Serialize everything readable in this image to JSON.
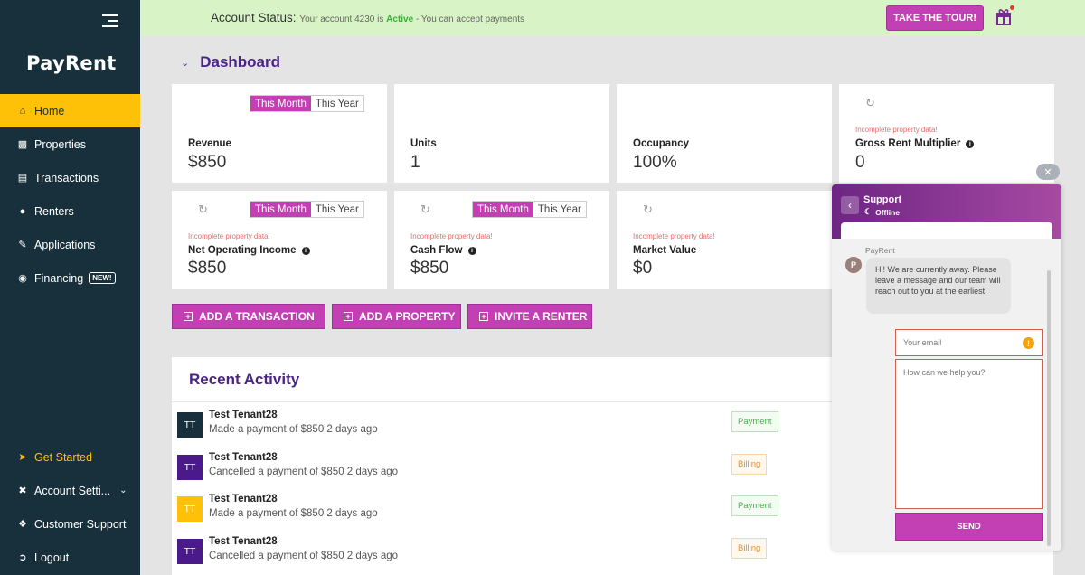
{
  "brand": {
    "logo_text": "PayRent"
  },
  "sidebar": {
    "items": [
      {
        "label": "Home",
        "icon": "home-icon"
      },
      {
        "label": "Properties",
        "icon": "buildings-icon"
      },
      {
        "label": "Transactions",
        "icon": "receipt-icon"
      },
      {
        "label": "Renters",
        "icon": "users-icon"
      },
      {
        "label": "Applications",
        "icon": "clipboard-icon"
      },
      {
        "label": "Financing",
        "icon": "money-bag-icon",
        "badge": "NEW!"
      }
    ],
    "bottom_items": [
      {
        "label": "Get Started",
        "icon": "rocket-icon"
      },
      {
        "label": "Account Setti...",
        "icon": "tools-icon"
      },
      {
        "label": "Customer Support",
        "icon": "support-icon"
      },
      {
        "label": "Logout",
        "icon": "logout-icon"
      }
    ]
  },
  "topbar": {
    "status_label": "Account Status:",
    "status_prefix": "Your account 4230 is",
    "status_active": "Active",
    "status_suffix": "- You can accept payments",
    "tour_button": "TAKE THE TOUR!"
  },
  "dashboard": {
    "title": "Dashboard",
    "toggle": {
      "month": "This Month",
      "year": "This Year"
    },
    "warning": "Incomplete property data!",
    "cards": [
      {
        "label": "Revenue",
        "value": "$850"
      },
      {
        "label": "Units",
        "value": "1"
      },
      {
        "label": "Occupancy",
        "value": "100%"
      },
      {
        "label": "Gross Rent Multiplier",
        "value": "0"
      },
      {
        "label": "Net Operating Income",
        "value": "$850"
      },
      {
        "label": "Cash Flow",
        "value": "$850"
      },
      {
        "label": "Market Value",
        "value": "$0"
      }
    ],
    "actions": {
      "add_transaction": "ADD A TRANSACTION",
      "add_property": "ADD A PROPERTY",
      "invite_renter": "INVITE A RENTER"
    }
  },
  "recent_activity": {
    "title": "Recent Activity",
    "rows": [
      {
        "initials": "TT",
        "name": "Test Tenant28",
        "desc": "Made a payment of $850 2 days ago",
        "tag": "Payment",
        "avatar_color": "#17303b"
      },
      {
        "initials": "TT",
        "name": "Test Tenant28",
        "desc": "Cancelled a payment of $850 2 days ago",
        "tag": "Billing",
        "avatar_color": "#4b1a8a"
      },
      {
        "initials": "TT",
        "name": "Test Tenant28",
        "desc": "Made a payment of $850 2 days ago",
        "tag": "Payment",
        "avatar_color": "#ffc107"
      },
      {
        "initials": "TT",
        "name": "Test Tenant28",
        "desc": "Cancelled a payment of $850 2 days ago",
        "tag": "Billing",
        "avatar_color": "#4b1a8a"
      }
    ]
  },
  "chat": {
    "title": "Support",
    "status": "Offline",
    "sender": "PayRent",
    "avatar_letter": "P",
    "message": "Hi! We are currently away. Please leave a message and our team will reach out to you at the earliest.",
    "email_placeholder": "Your email",
    "message_placeholder": "How can we help you?",
    "send_label": "SEND"
  },
  "colors": {
    "sidebar": "#17303b",
    "accent": "#c340b4",
    "highlight": "#ffc107",
    "heading": "#4b2584",
    "status_bar": "#d8f4c6"
  }
}
